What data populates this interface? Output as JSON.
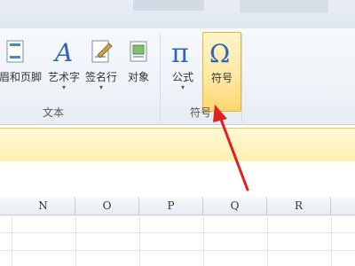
{
  "ribbon": {
    "buttons": [
      {
        "label": "眉和页脚"
      },
      {
        "label": "艺术字",
        "caret": "▾"
      },
      {
        "label": "签名行",
        "caret": "▾"
      },
      {
        "label": "对象"
      },
      {
        "label": "公式",
        "caret": "▾"
      },
      {
        "label": "符号"
      }
    ],
    "groups": [
      {
        "label": "文本"
      },
      {
        "label": "符号"
      }
    ]
  },
  "grid": {
    "columns": [
      "N",
      "O",
      "P",
      "Q",
      "R"
    ]
  },
  "colors": {
    "highlight": "#ffe7a1",
    "arrow": "#e0201e"
  }
}
